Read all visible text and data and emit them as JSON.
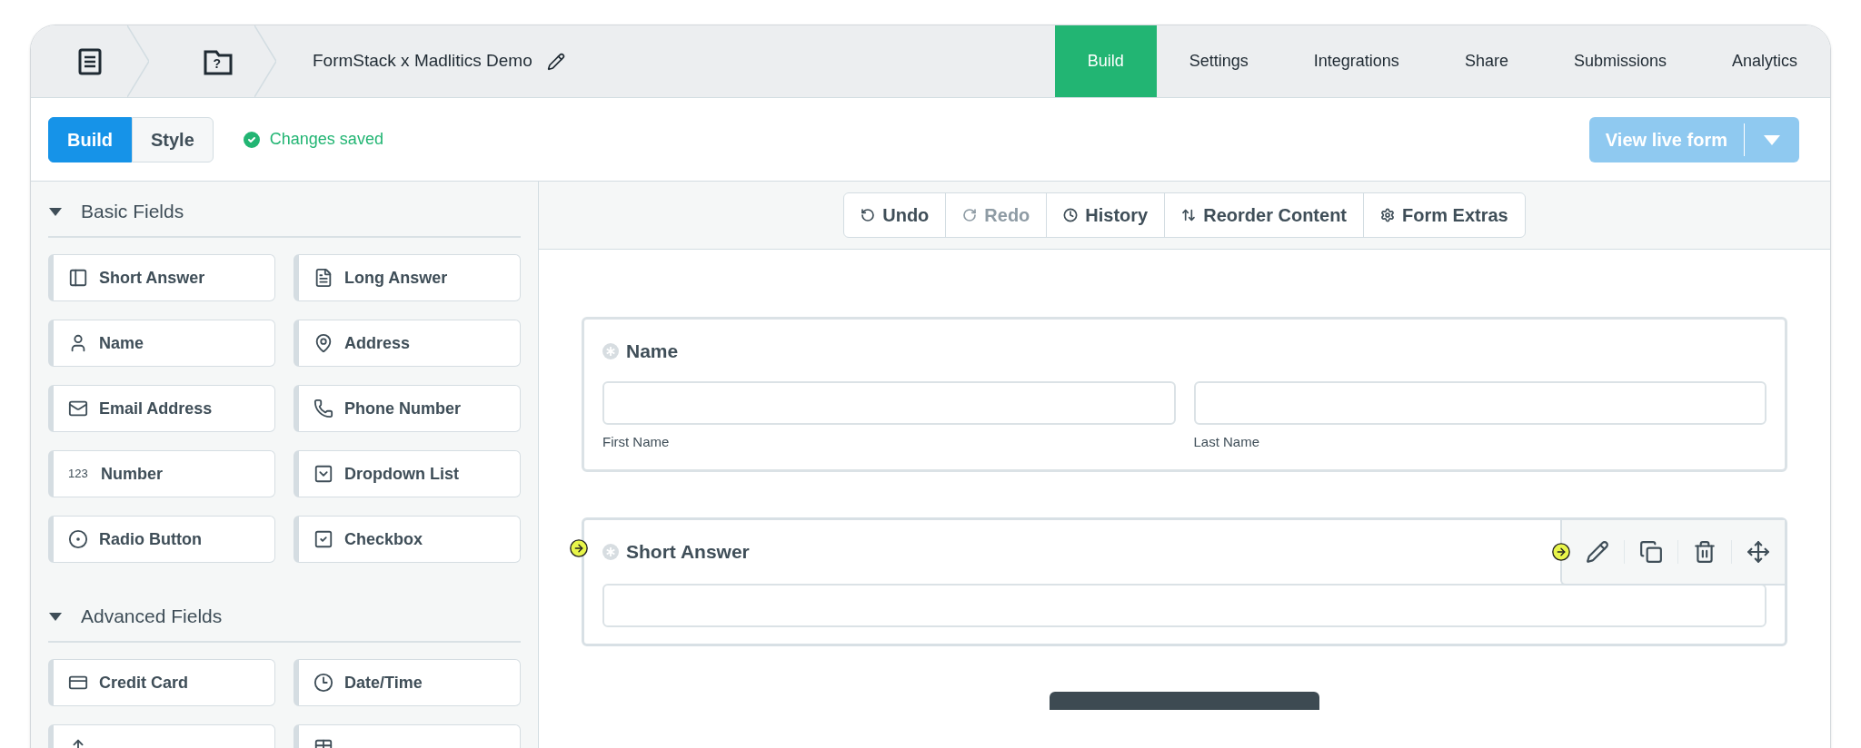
{
  "breadcrumb": {
    "form_icon_text": "?",
    "title": "FormStack x Madlitics Demo"
  },
  "nav_tabs": [
    {
      "label": "Build",
      "selected": true
    },
    {
      "label": "Settings",
      "selected": false
    },
    {
      "label": "Integrations",
      "selected": false
    },
    {
      "label": "Share",
      "selected": false
    },
    {
      "label": "Submissions",
      "selected": false
    },
    {
      "label": "Analytics",
      "selected": false
    }
  ],
  "mode_toggle": [
    {
      "label": "Build",
      "selected": true
    },
    {
      "label": "Style",
      "selected": false
    }
  ],
  "save_status": "Changes saved",
  "view_button": {
    "label": "View live form",
    "disabled": true
  },
  "sidebar": {
    "sections": [
      {
        "title": "Basic Fields",
        "expanded": true,
        "items": [
          {
            "kind": "short_answer",
            "label": "Short Answer"
          },
          {
            "kind": "long_answer",
            "label": "Long Answer"
          },
          {
            "kind": "name",
            "label": "Name"
          },
          {
            "kind": "address",
            "label": "Address"
          },
          {
            "kind": "email",
            "label": "Email Address"
          },
          {
            "kind": "phone",
            "label": "Phone Number"
          },
          {
            "kind": "number",
            "label": "Number",
            "icon_text": "123"
          },
          {
            "kind": "dropdown",
            "label": "Dropdown List"
          },
          {
            "kind": "radio",
            "label": "Radio Button"
          },
          {
            "kind": "checkbox",
            "label": "Checkbox"
          }
        ]
      },
      {
        "title": "Advanced Fields",
        "expanded": true,
        "items": [
          {
            "kind": "credit_card",
            "label": "Credit Card"
          },
          {
            "kind": "datetime",
            "label": "Date/Time"
          },
          {
            "kind": "file_upload"
          },
          {
            "kind": "table"
          }
        ]
      }
    ]
  },
  "toolbar": [
    {
      "kind": "undo",
      "label": "Undo",
      "disabled": false
    },
    {
      "kind": "redo",
      "label": "Redo",
      "disabled": true
    },
    {
      "kind": "history",
      "label": "History",
      "disabled": false
    },
    {
      "kind": "reorder",
      "label": "Reorder Content",
      "disabled": false
    },
    {
      "kind": "extras",
      "label": "Form Extras",
      "disabled": false
    }
  ],
  "form": {
    "fields": [
      {
        "kind": "name",
        "label": "Name",
        "selected": false,
        "annotated": false,
        "sublabels": [
          "First Name",
          "Last Name"
        ]
      },
      {
        "kind": "short_answer",
        "label": "Short Answer",
        "selected": true,
        "annotated": true
      }
    ]
  }
}
